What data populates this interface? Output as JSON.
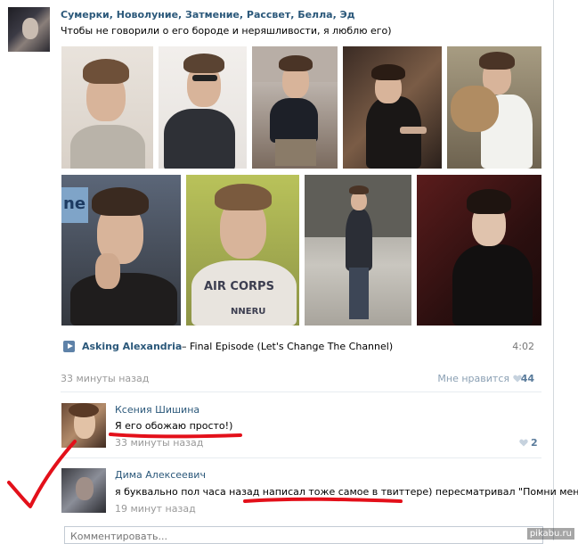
{
  "post": {
    "group_title": "Сумерки, Новолуние, Затмение, Рассвет, Белла, Эд",
    "text": "Чтобы не говорили о его бороде и неряшливости, я люблю его)",
    "photos_row1": [
      "photo-1",
      "photo-2",
      "photo-3",
      "photo-4",
      "photo-5"
    ],
    "photos_row2": [
      "photo-6",
      "photo-7",
      "photo-8",
      "photo-9"
    ],
    "photo_caption_fragment": "ne",
    "shirt_text": "AIR CORPS",
    "shirt_text2": "NNERU"
  },
  "audio": {
    "artist": "Asking Alexandria",
    "title": "– Final Episode (Let's Change The Channel)",
    "duration": "4:02",
    "icon": "play-icon"
  },
  "post_meta": {
    "time": "33 минуты назад",
    "like_label": "Мне нравится",
    "like_count": "44",
    "like_icon": "heart-icon"
  },
  "comments": [
    {
      "author": "Ксения Шишина",
      "text": "Я его обожаю просто!)",
      "time": "33 минуты назад",
      "likes": "2"
    },
    {
      "author": "Дима Алексеевич",
      "text": "я буквально пол часа назад написал тоже самое в твиттере) пересматривал \"Помни меня\")",
      "time": "19 минут назад"
    }
  ],
  "comment_box": {
    "placeholder": "Комментировать..."
  },
  "watermark": "pikabu.ru",
  "colors": {
    "link": "#2b587a",
    "like_count": "#5a7b9b",
    "annotation_red": "#e3101a"
  }
}
